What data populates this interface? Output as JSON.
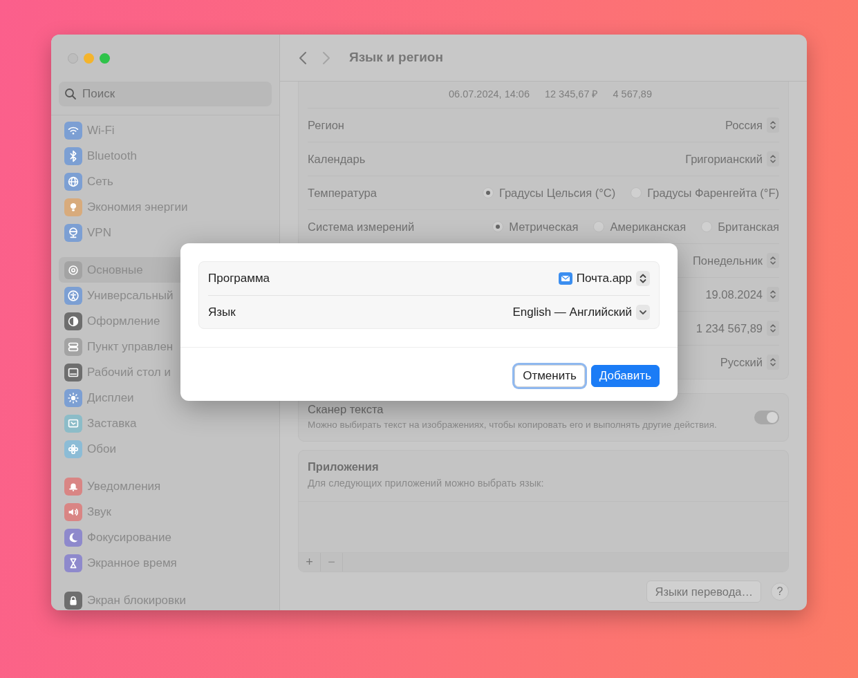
{
  "window": {
    "title": "Язык и регион"
  },
  "sidebar": {
    "search": {
      "placeholder": "Поиск"
    },
    "groups": [
      {
        "items": [
          {
            "label": "Wi-Fi",
            "selected": false,
            "color": "#7c9fd3"
          },
          {
            "label": "Bluetooth",
            "selected": false,
            "color": "#7c9fd3"
          },
          {
            "label": "Сеть",
            "selected": false,
            "color": "#7c9fd3"
          },
          {
            "label": "Экономия энергии",
            "selected": false,
            "color": "#d8ab7c"
          },
          {
            "label": "VPN",
            "selected": false,
            "color": "#7c9fd3"
          }
        ]
      },
      {
        "items": [
          {
            "label": "Основные",
            "selected": true,
            "color": "#a3a3a3"
          },
          {
            "label": "Универсальный",
            "selected": false,
            "color": "#7c9fd3"
          },
          {
            "label": "Оформление",
            "selected": false,
            "color": "#6e6e6e"
          },
          {
            "label": "Пункт управлен",
            "selected": false,
            "color": "#a3a3a3"
          },
          {
            "label": "Рабочий стол и",
            "selected": false,
            "color": "#6e6e6e"
          },
          {
            "label": "Дисплеи",
            "selected": false,
            "color": "#7c9fd3"
          },
          {
            "label": "Заставка",
            "selected": false,
            "color": "#8cbcc8"
          },
          {
            "label": "Обои",
            "selected": false,
            "color": "#8cbcd6"
          }
        ]
      },
      {
        "items": [
          {
            "label": "Уведомления",
            "selected": false,
            "color": "#d98584"
          },
          {
            "label": "Звук",
            "selected": false,
            "color": "#d98584"
          },
          {
            "label": "Фокусирование",
            "selected": false,
            "color": "#8e89cc"
          },
          {
            "label": "Экранное время",
            "selected": false,
            "color": "#8e89cc"
          }
        ]
      },
      {
        "items": [
          {
            "label": "Экран блокировки",
            "selected": false,
            "color": "#6e6e6e"
          }
        ]
      }
    ]
  },
  "settings_rows": [
    {
      "kind": "preview",
      "texts": [
        "06.07.2024, 14:06",
        "12 345,67 ₽",
        "4 567,89"
      ]
    },
    {
      "kind": "popup",
      "label": "Регион",
      "value": "Россия"
    },
    {
      "kind": "popup",
      "label": "Календарь",
      "value": "Григорианский"
    },
    {
      "kind": "radio",
      "label": "Температура",
      "options": [
        {
          "label": "Градусы Цельсия (°C)",
          "selected": true
        },
        {
          "label": "Градусы Фаренгейта (°F)",
          "selected": false
        }
      ]
    },
    {
      "kind": "radio",
      "label": "Система измерений",
      "options": [
        {
          "label": "Метрическая",
          "selected": true
        },
        {
          "label": "Американская",
          "selected": false
        },
        {
          "label": "Британская",
          "selected": false
        }
      ]
    },
    {
      "kind": "popup",
      "value": "Понедельник"
    },
    {
      "kind": "popup",
      "value": "19.08.2024"
    },
    {
      "kind": "popup",
      "value": "1 234 567,89"
    },
    {
      "kind": "popup",
      "value": "Русский"
    }
  ],
  "text_scanner": {
    "title": "Сканер текста",
    "description": "Можно выбирать текст на изображениях, чтобы копировать его и выполнять другие действия.",
    "on": true
  },
  "apps": {
    "title": "Приложения",
    "description": "Для следующих приложений можно выбрать язык:",
    "buttons": [
      {
        "label": "+",
        "disabled": false
      },
      {
        "label": "−",
        "disabled": true
      }
    ]
  },
  "footer": {
    "translation_button": "Языки перевода…",
    "help_button": "?"
  },
  "dialog": {
    "rows": [
      {
        "kind": "stepper",
        "label": "Программа",
        "value": "Почта.app"
      },
      {
        "kind": "dropdown",
        "label": "Язык",
        "value": "English — Английский"
      }
    ],
    "buttons": [
      {
        "label": "Отменить",
        "default": false,
        "focused": true
      },
      {
        "label": "Добавить",
        "default": true,
        "focused": false
      }
    ]
  }
}
